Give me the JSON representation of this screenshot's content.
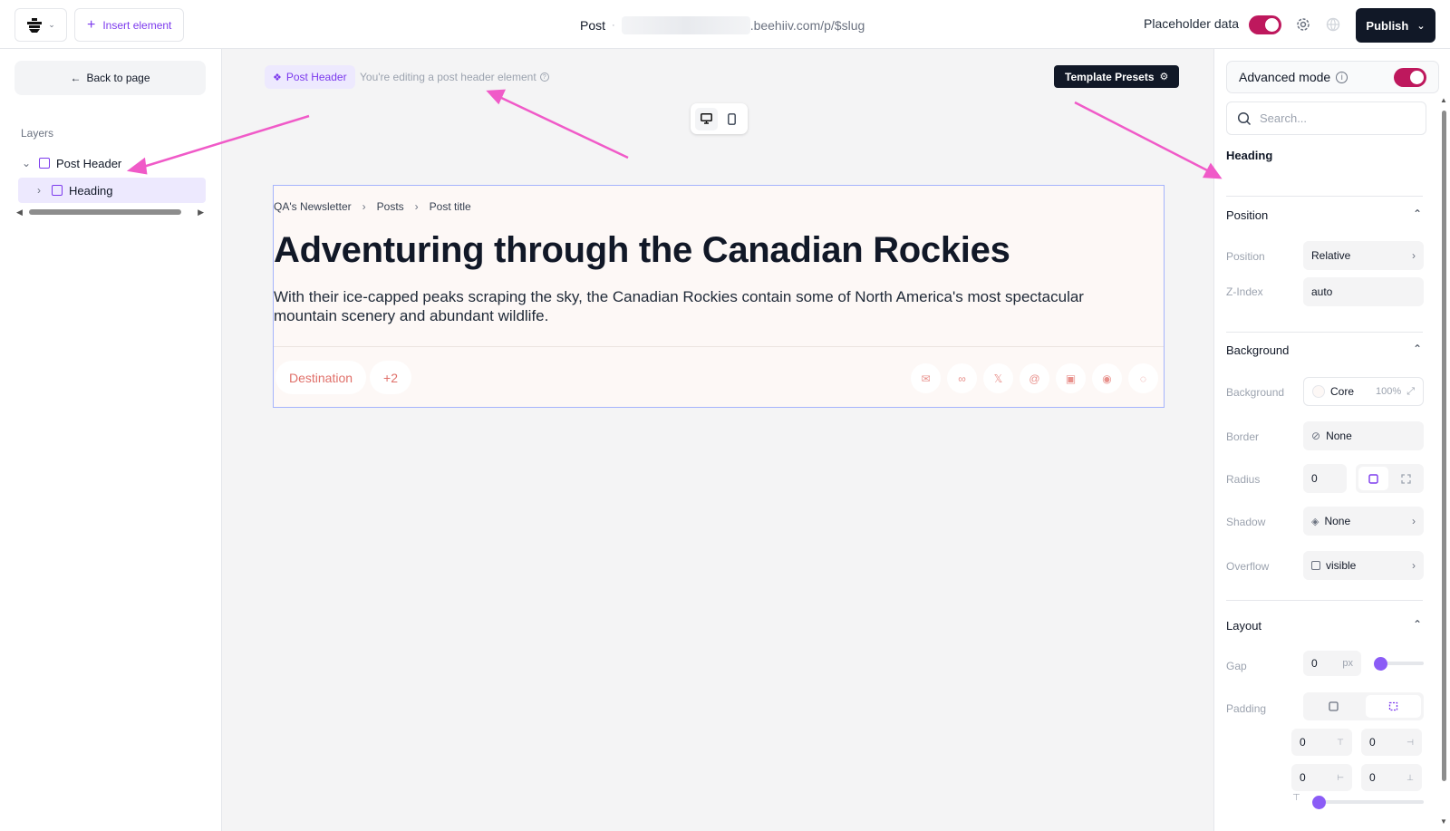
{
  "topbar": {
    "insert_label": "Insert element",
    "crumb_post": "Post",
    "crumb_sep": "·",
    "crumb_url": ".beehiiv.com/p/$slug",
    "placeholder_label": "Placeholder data",
    "placeholder_on": true,
    "publish_label": "Publish"
  },
  "sidebar": {
    "back_label": "Back to page",
    "layers_title": "Layers",
    "layers": [
      {
        "label": "Post Header"
      },
      {
        "label": "Heading"
      }
    ]
  },
  "canvas": {
    "chip_label": "Post Header",
    "editing_note": "You're editing a post header element",
    "presets_label": "Template Presets",
    "preview": {
      "breadcrumbs": [
        "QA's Newsletter",
        "Posts",
        "Post title"
      ],
      "title": "Adventuring through the Canadian Rockies",
      "subtitle": "With their ice-capped peaks scraping the sky, the Canadian Rockies contain some of North America's most spectacular mountain scenery and abundant wildlife.",
      "tags": [
        "Destination",
        "+2"
      ],
      "share_icons": [
        "email-icon",
        "meta-icon",
        "x-icon",
        "threads-icon",
        "linkedin-icon",
        "reddit-icon",
        "whatsapp-icon"
      ]
    },
    "annotation_color": "#f05ac8"
  },
  "panel": {
    "advanced_label": "Advanced mode",
    "advanced_on": true,
    "search_placeholder": "Search...",
    "heading_label": "Heading",
    "position": {
      "title": "Position",
      "position_label": "Position",
      "position_value": "Relative",
      "z_label": "Z-Index",
      "z_value": "auto"
    },
    "background": {
      "title": "Background",
      "bg_label": "Background",
      "bg_value": "Core",
      "bg_opacity": "100%",
      "border_label": "Border",
      "border_value": "None",
      "radius_label": "Radius",
      "radius_value": "0",
      "shadow_label": "Shadow",
      "shadow_value": "None",
      "overflow_label": "Overflow",
      "overflow_value": "visible"
    },
    "layout": {
      "title": "Layout",
      "gap_label": "Gap",
      "gap_value": "0",
      "gap_unit": "px",
      "padding_label": "Padding",
      "padding_values": [
        "0",
        "0",
        "0",
        "0"
      ]
    }
  },
  "colors": {
    "accent": "#7c3aed",
    "toggle": "#be185d",
    "dark": "#111827"
  }
}
